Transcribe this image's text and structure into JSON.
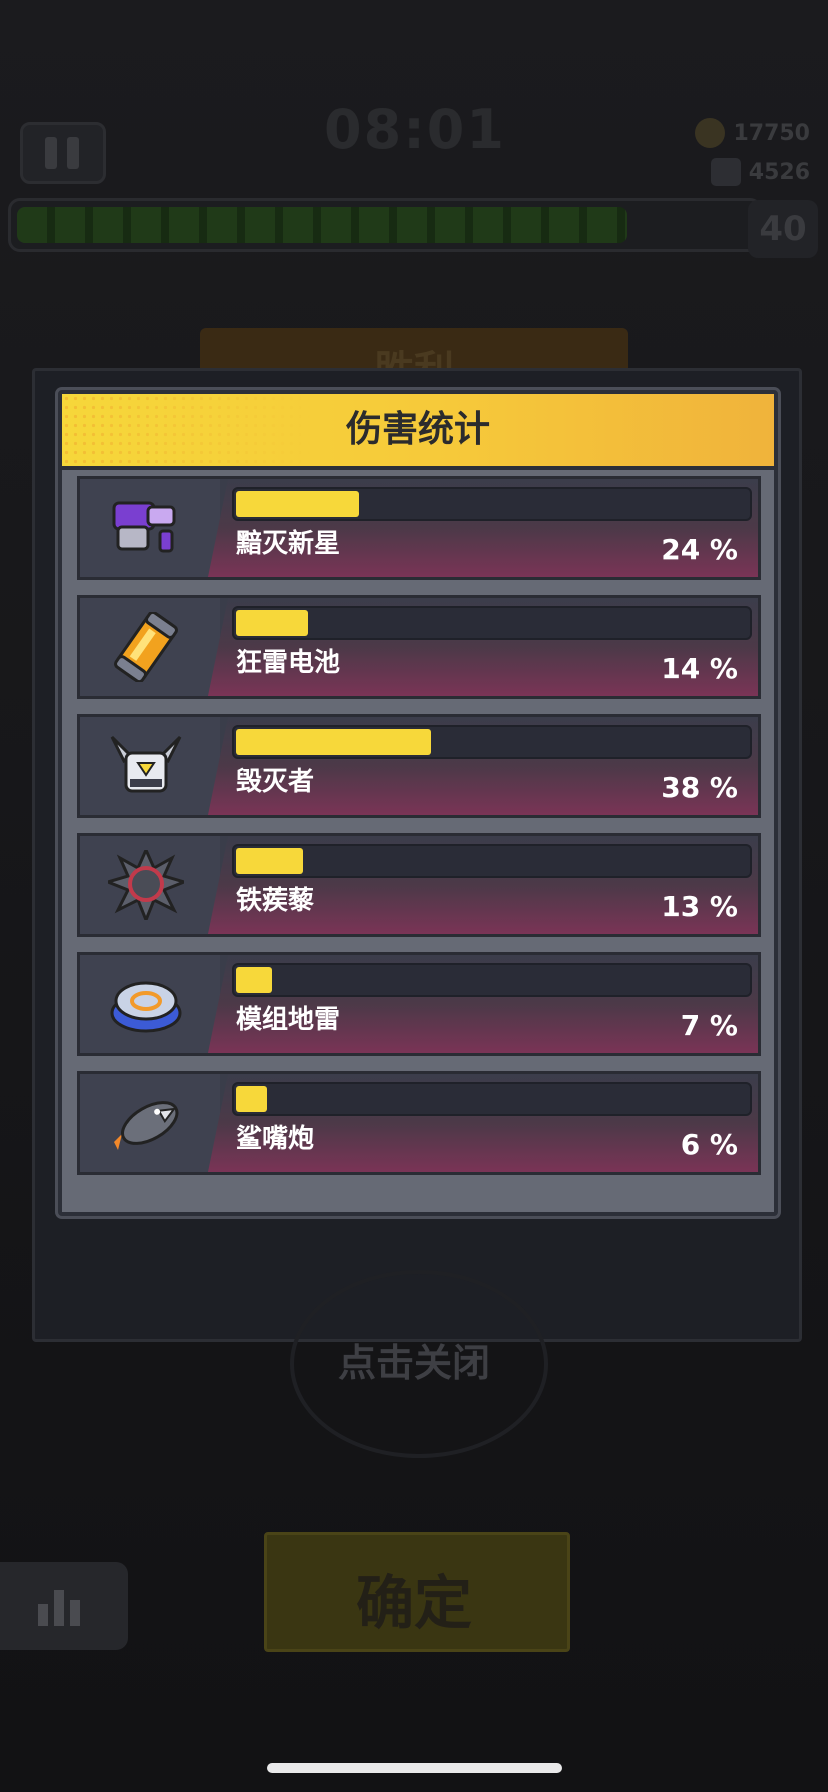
{
  "hud": {
    "timer": "08:01",
    "gold": "17750",
    "gems": "4526",
    "level": "40",
    "xp_progress": 0.82
  },
  "victory_title": "胜利",
  "panel": {
    "title": "伤害统计",
    "items": [
      {
        "name": "黯灭新星",
        "percent_text": "24 %",
        "percent": 24,
        "icon": "purple-blaster-icon"
      },
      {
        "name": "狂雷电池",
        "percent_text": "14 %",
        "percent": 14,
        "icon": "battery-icon"
      },
      {
        "name": "毁灭者",
        "percent_text": "38 %",
        "percent": 38,
        "icon": "robot-destroyer-icon"
      },
      {
        "name": "铁蒺藜",
        "percent_text": "13 %",
        "percent": 13,
        "icon": "spiked-ball-icon"
      },
      {
        "name": "模组地雷",
        "percent_text": "7 %",
        "percent": 7,
        "icon": "landmine-icon"
      },
      {
        "name": "鲨嘴炮",
        "percent_text": "6 %",
        "percent": 6,
        "icon": "shark-rocket-icon"
      }
    ]
  },
  "close_hint": "点击关闭",
  "confirm_label": "确定",
  "colors": {
    "header_yellow": "#f6d73a",
    "bar_fill": "#f7d83a",
    "panel_bg": "#666a75",
    "row_bg": "#3a3d4a"
  }
}
